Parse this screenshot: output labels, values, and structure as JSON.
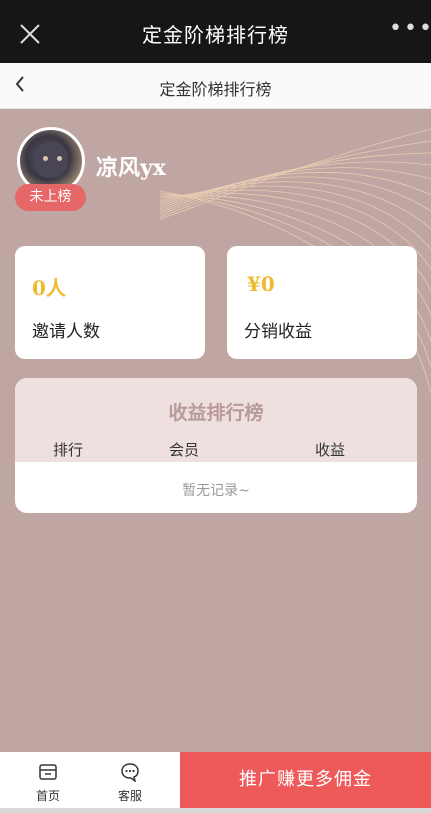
{
  "window": {
    "title": "定金阶梯排行榜",
    "close_icon": "close-icon",
    "more_icon": "more-icon"
  },
  "nav": {
    "title": "定金阶梯排行榜",
    "back_icon": "chevron-left-icon"
  },
  "profile": {
    "name": "凉风yx",
    "rank_badge": "未上榜"
  },
  "stats": [
    {
      "value": "0人",
      "label": "邀请人数"
    },
    {
      "value": "¥0",
      "label": "分销收益"
    }
  ],
  "ranking": {
    "title": "收益排行榜",
    "columns": [
      "排行",
      "会员",
      "收益"
    ],
    "empty_text": "暂无记录~"
  },
  "bottom_nav": {
    "items": [
      {
        "label": "首页",
        "icon": "home-icon"
      },
      {
        "label": "客服",
        "icon": "chat-icon"
      }
    ],
    "cta": "推广赚更多佣金"
  },
  "colors": {
    "background": "#c0a6a2",
    "accent_red": "#ee5a5a",
    "gold": "#f0b92e"
  }
}
